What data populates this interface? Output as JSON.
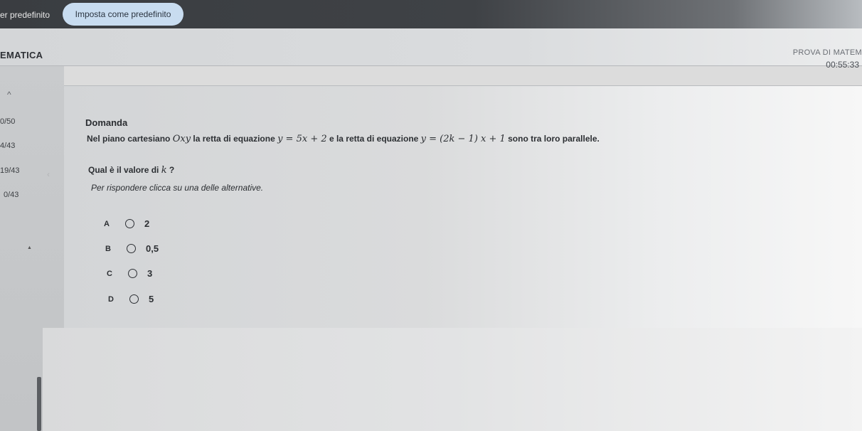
{
  "topbar": {
    "left_link": "er predefinito",
    "default_button": "Imposta come predefinito"
  },
  "header": {
    "exam_name": "PROVA DI MATEM",
    "timer": "00:55:33",
    "subject": "EMATICA"
  },
  "sidebar": {
    "scores": [
      "0/50",
      "4/43",
      "19/43",
      "0/43"
    ]
  },
  "question": {
    "title": "Domanda",
    "text_part1": "Nel piano cartesiano ",
    "text_math1": "Oxy",
    "text_part2": " la retta di equazione ",
    "text_math2": "y = 5x + 2",
    "text_part3": " e la retta di equazione ",
    "text_math3": "y = (2k − 1) x + 1",
    "text_part4": " sono tra loro parallele.",
    "sub_part1": "Qual è il valore di ",
    "sub_math": "k",
    "sub_part2": " ?",
    "hint": "Per rispondere clicca su una delle alternative.",
    "options": [
      {
        "letter": "A",
        "value": "2"
      },
      {
        "letter": "B",
        "value": "0,5"
      },
      {
        "letter": "C",
        "value": "3"
      },
      {
        "letter": "D",
        "value": "5"
      }
    ]
  }
}
